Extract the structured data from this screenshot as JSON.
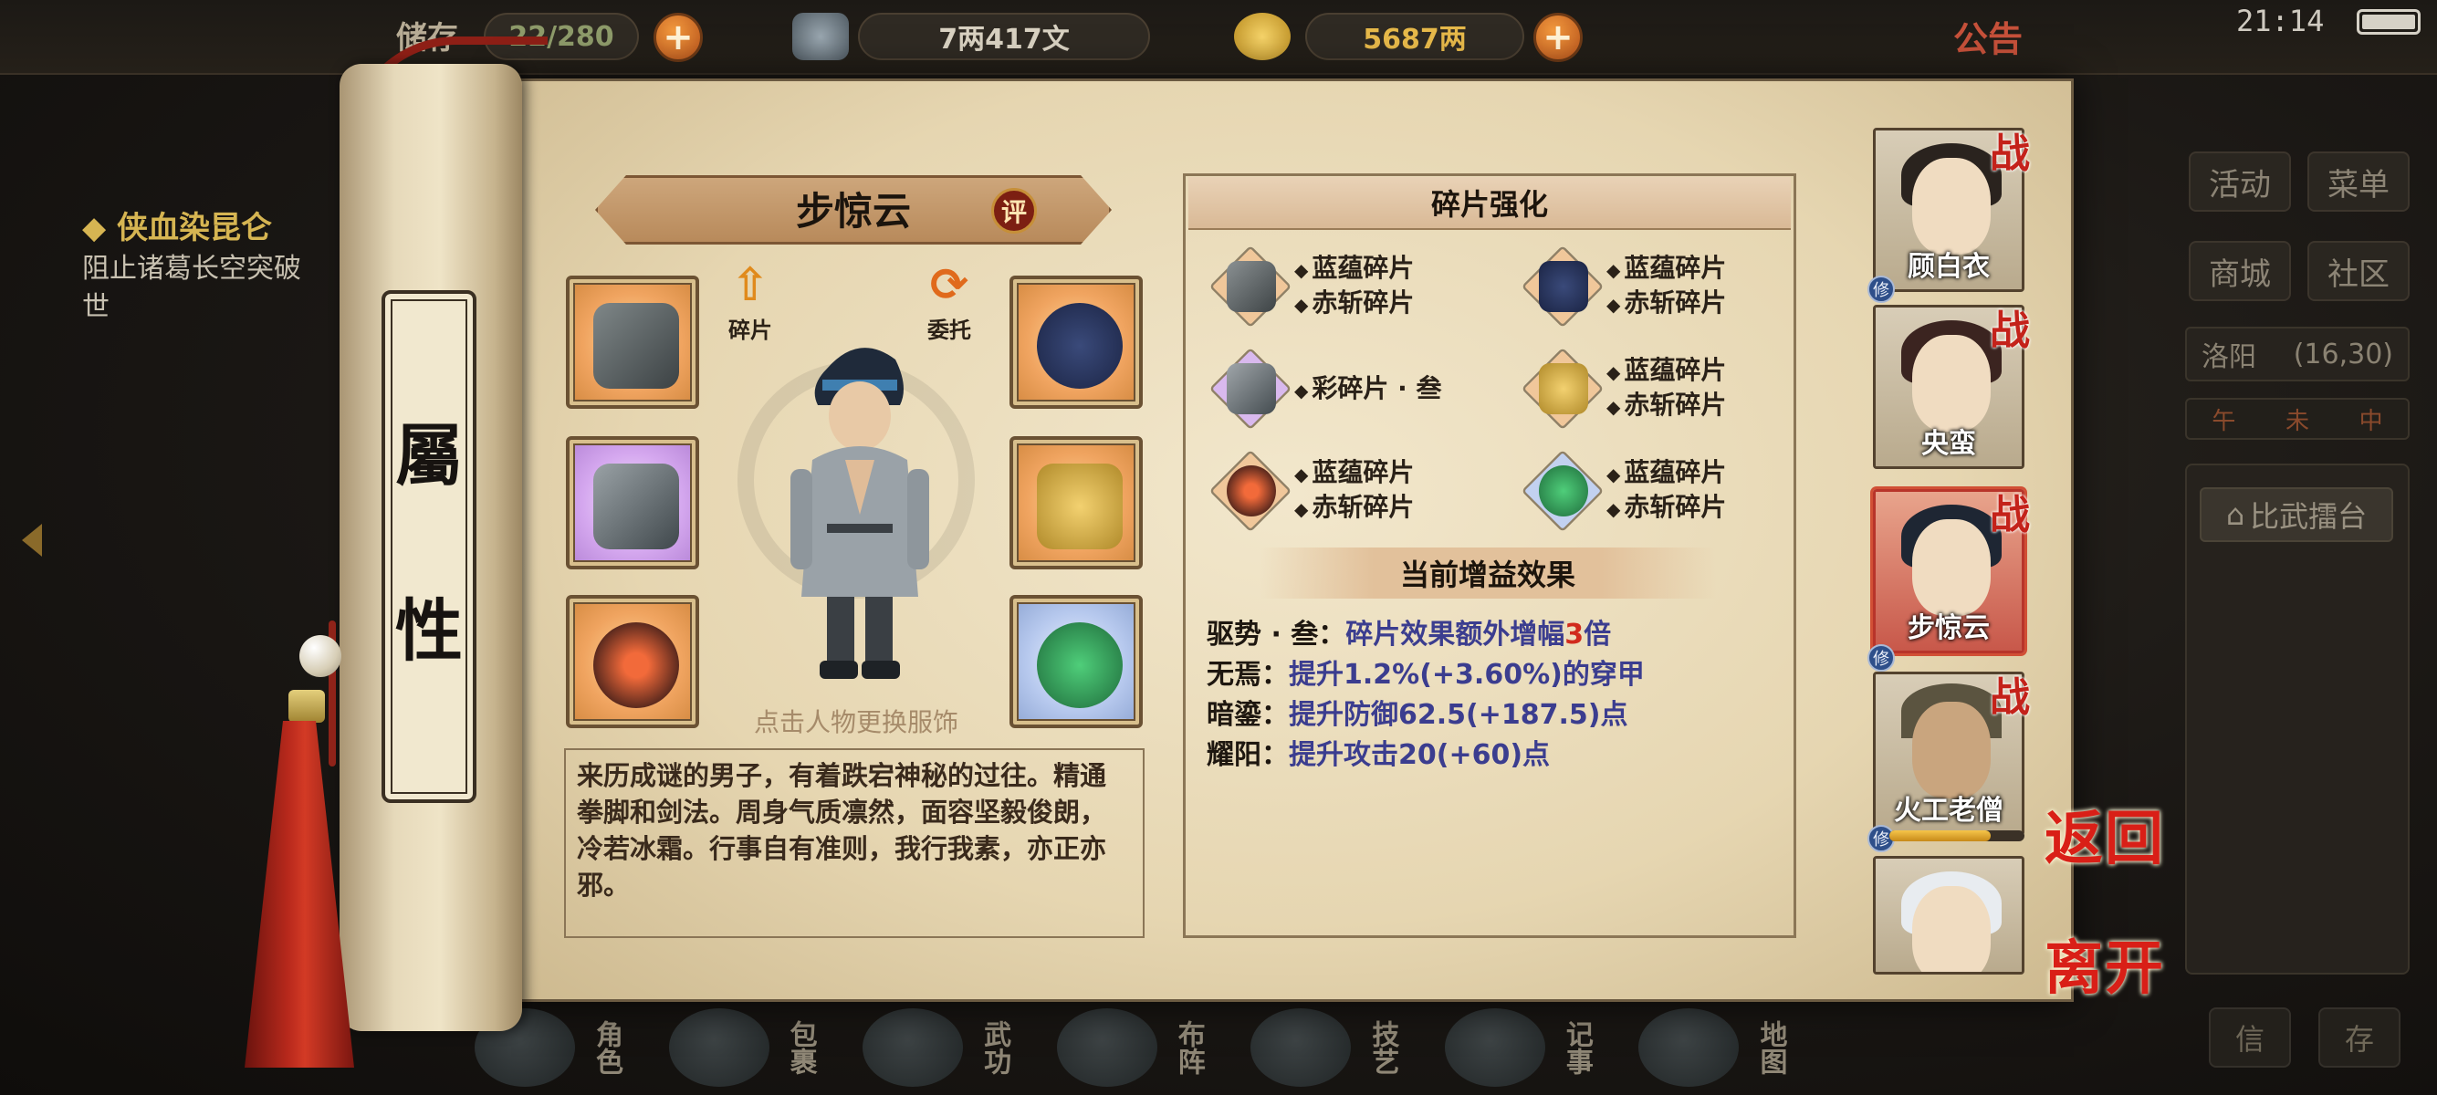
{
  "hud": {
    "bag_label": "储存",
    "bag_count": "22/280",
    "silver": "7两417文",
    "gold": "5687两",
    "notice": "公告",
    "clock": "21:14"
  },
  "quest": {
    "title": "◆ 侠血染昆仑",
    "desc": "阻止诸葛长空突破世"
  },
  "side_menu": {
    "activity": "活动",
    "menu": "菜单",
    "shop": "商城",
    "community": "社区",
    "city": "洛阳",
    "coords": "(16,30)",
    "time_a": "午",
    "time_b": "未",
    "time_c": "中",
    "arena": "比武擂台",
    "letter": "信",
    "save": "存"
  },
  "bottom_nav": [
    {
      "label": "角色",
      "icon": "character-icon"
    },
    {
      "label": "包裹",
      "icon": "bag-icon"
    },
    {
      "label": "武功",
      "icon": "martial-icon"
    },
    {
      "label": "布阵",
      "icon": "formation-icon"
    },
    {
      "label": "技艺",
      "icon": "skill-icon"
    },
    {
      "label": "记事",
      "icon": "journal-icon"
    },
    {
      "label": "地图",
      "icon": "map-icon"
    }
  ],
  "scroll": {
    "char1": "屬",
    "char2": "性"
  },
  "character": {
    "name": "步惊云",
    "rate_badge": "评",
    "fragment_btn": "碎片",
    "entrust_btn": "委托",
    "hint": "点击人物更换服饰",
    "description": "来历成谜的男子，有着跌宕神秘的过往。精通拳脚和剑法。周身气质凛然，面容坚毅俊朗，冷若冰霜。行事自有准则，我行我素，亦正亦邪。"
  },
  "equipment": [
    {
      "slot": "gauntlet",
      "rarity": "orange"
    },
    {
      "slot": "hat",
      "rarity": "orange"
    },
    {
      "slot": "claw",
      "rarity": "purple"
    },
    {
      "slot": "armor",
      "rarity": "orange"
    },
    {
      "slot": "ring",
      "rarity": "orange"
    },
    {
      "slot": "jade",
      "rarity": "blue"
    }
  ],
  "fragments": {
    "title": "碎片强化",
    "items": [
      {
        "line1": "蓝蕴碎片",
        "line2": "赤斩碎片"
      },
      {
        "line1": "蓝蕴碎片",
        "line2": "赤斩碎片"
      },
      {
        "line1": "彩碎片 · 叁",
        "line2": ""
      },
      {
        "line1": "蓝蕴碎片",
        "line2": "赤斩碎片"
      },
      {
        "line1": "蓝蕴碎片",
        "line2": "赤斩碎片"
      },
      {
        "line1": "蓝蕴碎片",
        "line2": "赤斩碎片"
      }
    ]
  },
  "effects": {
    "title": "当前增益效果",
    "rows": [
      {
        "key": "驱势 · 叁：",
        "val": "碎片效果额外增幅",
        "red": "3",
        "tail": "倍"
      },
      {
        "key": "无焉：",
        "val": "提升1.2%(+3.60%)的穿甲",
        "red": "",
        "tail": ""
      },
      {
        "key": "暗鎏：",
        "val": "提升防御62.5(+187.5)点",
        "red": "",
        "tail": ""
      },
      {
        "key": "耀阳：",
        "val": "提升攻击20(+60)点",
        "red": "",
        "tail": ""
      }
    ]
  },
  "roster": [
    {
      "name": "顾白衣",
      "war": "战",
      "xiu": "修"
    },
    {
      "name": "央蛮",
      "war": "战",
      "xiu": ""
    },
    {
      "name": "步惊云",
      "war": "战",
      "xiu": "修"
    },
    {
      "name": "火工老僧",
      "war": "战",
      "xiu": "修"
    },
    {
      "name": "",
      "war": "",
      "xiu": ""
    }
  ],
  "roster_progress": 0.75,
  "actions": {
    "return": "返回",
    "leave": "离开"
  },
  "colors": {
    "accent_red": "#d12a1d",
    "effect_blue": "#3b3d8f",
    "parchment": "#e6d6b1"
  }
}
